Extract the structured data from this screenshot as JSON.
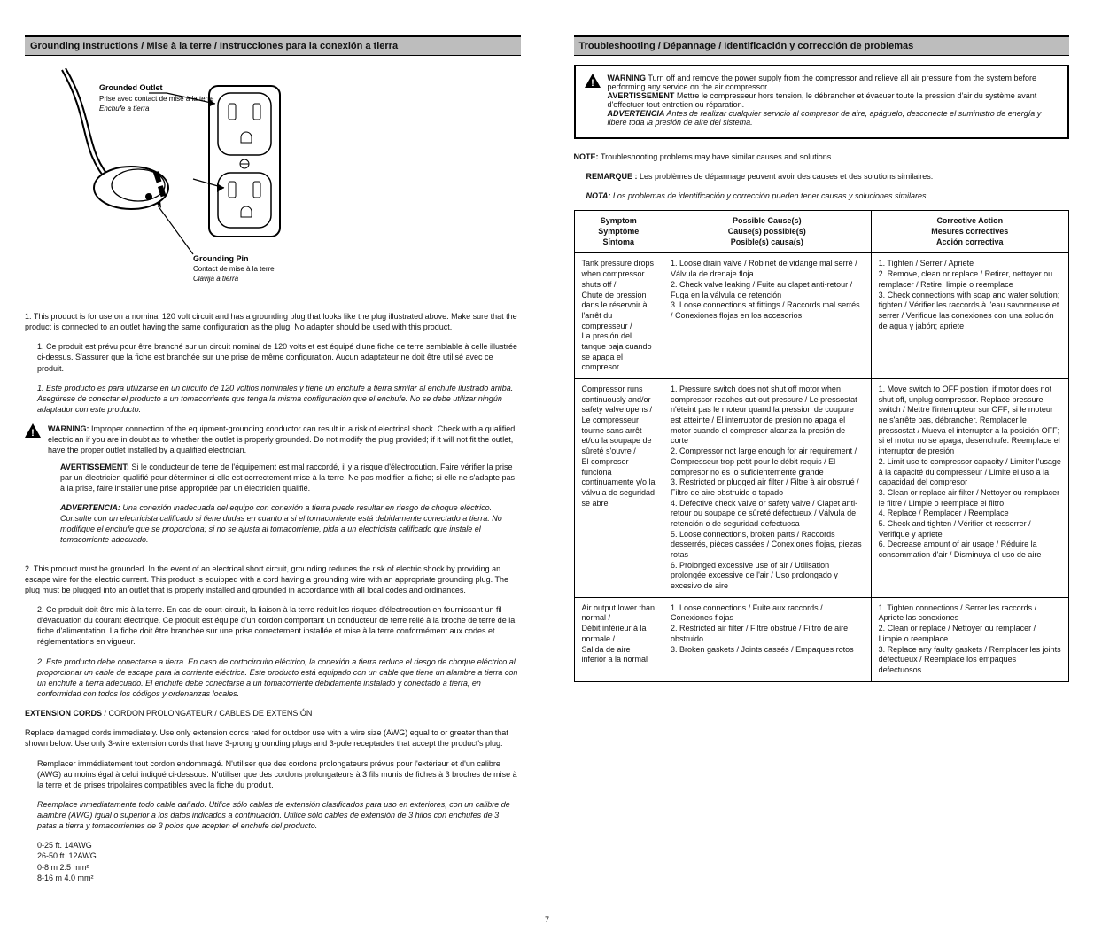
{
  "left": {
    "heading_en": "Grounding Instructions",
    "heading_combined": " / Mise à la terre / Instrucciones para la conexión a tierra",
    "fig_grounded_outlet_en": "Grounded Outlet",
    "fig_grounded_outlet_fr": "Prise avec contact de mise à la terre",
    "fig_grounded_outlet_es": "Enchufe a tierra",
    "fig_grounding_pin_en": "Grounding Pin",
    "fig_grounding_pin_fr": "Contact de mise à la terre",
    "fig_grounding_pin_es": "Clavija a tierra",
    "para1_en": "1. This product is for use on a nominal 120 volt circuit and has a grounding plug that looks like the plug illustrated above. Make sure that the product is connected to an outlet having the same configuration as the plug. No adapter should be used with this product.",
    "para1_fr": "1. Ce produit est prévu pour être branché sur un circuit nominal de 120 volts et est équipé d'une fiche de terre semblable à celle illustrée ci-dessus. S'assurer que la fiche est branchée sur une prise de même configuration. Aucun adaptateur ne doit être utilisé avec ce produit.",
    "para1_es": "1. Este producto es para utilizarse en un circuito de 120 voltios nominales y tiene un enchufe a tierra similar al enchufe ilustrado arriba. Asegúrese de conectar el producto a un tomacorriente que tenga la misma configuración que el enchufe. No se debe utilizar ningún adaptador con este producto.",
    "warn_word": "WARNING: ",
    "warn_en": "Improper connection of the equipment-grounding conductor can result in a risk of electrical shock. Check with a qualified electrician if you are in doubt as to whether the outlet is properly grounded. Do not modify the plug provided; if it will not fit the outlet, have the proper outlet installed by a qualified electrician.",
    "avert_word": "AVERTISSEMENT: ",
    "warn_fr": "Si le conducteur de terre de l'équipement est mal raccordé, il y a risque d'électrocution. Faire vérifier la prise par un électricien qualifié pour déterminer si elle est correctement mise à la terre. Ne pas modifier la fiche; si elle ne s'adapte pas à la prise, faire installer une prise appropriée par un électricien qualifié.",
    "adv_word": "ADVERTENCIA: ",
    "warn_es": "Una conexión inadecuada del equipo con conexión a tierra puede resultar en riesgo de choque eléctrico. Consulte con un electricista calificado si tiene dudas en cuanto a si el tomacorriente está debidamente conectado a tierra. No modifique el enchufe que se proporciona; si no se ajusta al tomacorriente, pida a un electricista calificado que instale el tomacorriente adecuado.",
    "para2_en": "2. This product must be grounded. In the event of an electrical short circuit, grounding reduces the risk of electric shock by providing an escape wire for the electric current. This product is equipped with a cord having a grounding wire with an appropriate grounding plug. The plug must be plugged into an outlet that is properly installed and grounded in accordance with all local codes and ordinances.",
    "para2_fr": "2. Ce produit doit être mis à la terre. En cas de court-circuit, la liaison à la terre réduit les risques d'électrocution en fournissant un fil d'évacuation du courant électrique. Ce produit est équipé d'un cordon comportant un conducteur de terre relié à la broche de terre de la fiche d'alimentation. La fiche doit être branchée sur une prise correctement installée et mise à la terre conformément aux codes et réglementations en vigueur.",
    "para2_es": "2. Este producto debe conectarse a tierra. En caso de cortocircuito eléctrico, la conexión a tierra reduce el riesgo de choque eléctrico al proporcionar un cable de escape para la corriente eléctrica. Este producto está equipado con un cable que tiene un alambre a tierra con un enchufe a tierra adecuado. El enchufe debe conectarse a un tomacorriente debidamente instalado y conectado a tierra, en conformidad con todos los códigos y ordenanzas locales.",
    "ext_heading_en": "EXTENSION CORDS",
    "ext_heading_rest": " / CORDON PROLONGATEUR / CABLES DE EXTENSIÓN",
    "ext_en": "Replace damaged cords immediately. Use only extension cords rated for outdoor use with a wire size (AWG) equal to or greater than that shown below. Use only 3-wire extension cords that have 3-prong grounding plugs and 3-pole receptacles that accept the product's plug.",
    "ext_fr": "Remplacer immédiatement tout cordon endommagé. N'utiliser que des cordons prolongateurs prévus pour l'extérieur et d'un calibre (AWG) au moins égal à celui indiqué ci-dessous. N'utiliser que des cordons prolongateurs à 3 fils munis de fiches à 3 broches de mise à la terre et de prises tripolaires compatibles avec la fiche du produit.",
    "ext_es": "Reemplace inmediatamente todo cable dañado. Utilice sólo cables de extensión clasificados para uso en exteriores, con un calibre de alambre (AWG) igual o superior a los datos indicados a continuación. Utilice sólo cables de extensión de 3 hilos con enchufes de 3 patas a tierra y tomacorrientes de 3 polos que acepten el enchufe del producto.",
    "ext_specs": [
      "0-25 ft. 14AWG",
      "26-50 ft. 12AWG",
      "0-8 m 2.5 mm²",
      "8-16 m 4.0 mm²"
    ]
  },
  "right": {
    "heading_en": "Troubleshooting",
    "heading_combined": " / Dépannage / Identificación y corrección de problemas",
    "callout_warn_en_label": "WARNING",
    "callout_warn_en": " Turn off and remove the power supply from the compressor and relieve all air pressure from the system before performing any service on the air compressor.",
    "callout_warn_fr_label": "AVERTISSEMENT",
    "callout_warn_fr": " Mettre le compresseur hors tension, le débrancher et évacuer toute la pression d'air du système avant d'effectuer tout entretien ou réparation.",
    "callout_warn_es_label": "ADVERTENCIA",
    "callout_warn_es": " Antes de realizar cualquier servicio al compresor de aire, apáguelo, desconecte el suministro de energía y libere toda la presión de aire del sistema.",
    "note_en_label": "NOTE: ",
    "note_en": "Troubleshooting problems may have similar causes and solutions.",
    "note_fr_label": "REMARQUE : ",
    "note_fr": "Les problèmes de dépannage peuvent avoir des causes et des solutions similaires.",
    "note_es_label": "NOTA: ",
    "note_es": "Los problemas de identificación y corrección pueden tener causas y soluciones similares.",
    "table": {
      "head_symptom": "Symptom\nSymptôme\nSíntoma",
      "head_cause": "Possible Cause(s)\nCause(s) possible(s)\nPosible(s) causa(s)",
      "head_action": "Corrective Action\nMesures correctives\nAcción correctiva",
      "rows": [
        {
          "symptom": "Tank pressure drops when compressor shuts off /\nChute de pression dans le réservoir à l'arrêt du compresseur /\nLa presión del tanque baja cuando se apaga el compresor",
          "cause": "1. Loose drain valve / Robinet de vidange mal serré / Válvula de drenaje floja\n2. Check valve leaking / Fuite au clapet anti-retour / Fuga en la válvula de retención\n3. Loose connections at fittings / Raccords mal serrés / Conexiones flojas en los accesorios",
          "action": "1. Tighten / Serrer / Apriete\n2. Remove, clean or replace / Retirer, nettoyer ou remplacer / Retire, limpie o reemplace\n3. Check connections with soap and water solution; tighten / Vérifier les raccords à l'eau savonneuse et serrer / Verifique las conexiones con una solución de agua y jabón; apriete"
        },
        {
          "symptom": "Compressor runs continuously and/or safety valve opens /\nLe compresseur tourne sans arrêt et/ou la soupape de sûreté s'ouvre /\nEl compresor funciona continuamente y/o la válvula de seguridad se abre",
          "cause": "1. Pressure switch does not shut off motor when compressor reaches cut-out pressure / Le pressostat n'éteint pas le moteur quand la pression de coupure est atteinte / El interruptor de presión no apaga el motor cuando el compresor alcanza la presión de corte\n2. Compressor not large enough for air requirement / Compresseur trop petit pour le débit requis / El compresor no es lo suficientemente grande\n3. Restricted or plugged air filter / Filtre à air obstrué / Filtro de aire obstruido o tapado\n4. Defective check valve or safety valve / Clapet anti-retour ou soupape de sûreté défectueux / Válvula de retención o de seguridad defectuosa\n5. Loose connections, broken parts / Raccords desserrés, pièces cassées / Conexiones flojas, piezas rotas\n6. Prolonged excessive use of air / Utilisation prolongée excessive de l'air / Uso prolongado y excesivo de aire",
          "action": "1. Move switch to OFF position; if motor does not shut off, unplug compressor. Replace pressure switch / Mettre l'interrupteur sur OFF; si le moteur ne s'arrête pas, débrancher. Remplacer le pressostat / Mueva el interruptor a la posición OFF; si el motor no se apaga, desenchufe. Reemplace el interruptor de presión\n2. Limit use to compressor capacity / Limiter l'usage à la capacité du compresseur / Limite el uso a la capacidad del compresor\n3. Clean or replace air filter / Nettoyer ou remplacer le filtre / Limpie o reemplace el filtro\n4. Replace / Remplacer / Reemplace\n5. Check and tighten / Vérifier et resserrer / Verifique y apriete\n6. Decrease amount of air usage / Réduire la consommation d'air / Disminuya el uso de aire"
        },
        {
          "symptom": "Air output lower than normal /\nDébit inférieur à la normale /\nSalida de aire inferior a la normal",
          "cause": "1. Loose connections / Fuite aux raccords / Conexiones flojas\n2. Restricted air filter / Filtre obstrué / Filtro de aire obstruido\n3. Broken gaskets / Joints cassés / Empaques rotos",
          "action": "1. Tighten connections / Serrer les raccords / Apriete las conexiones\n2. Clean or replace / Nettoyer ou remplacer / Limpie o reemplace\n3. Replace any faulty gaskets / Remplacer les joints défectueux / Reemplace los empaques defectuosos"
        }
      ]
    }
  },
  "footer": "7"
}
